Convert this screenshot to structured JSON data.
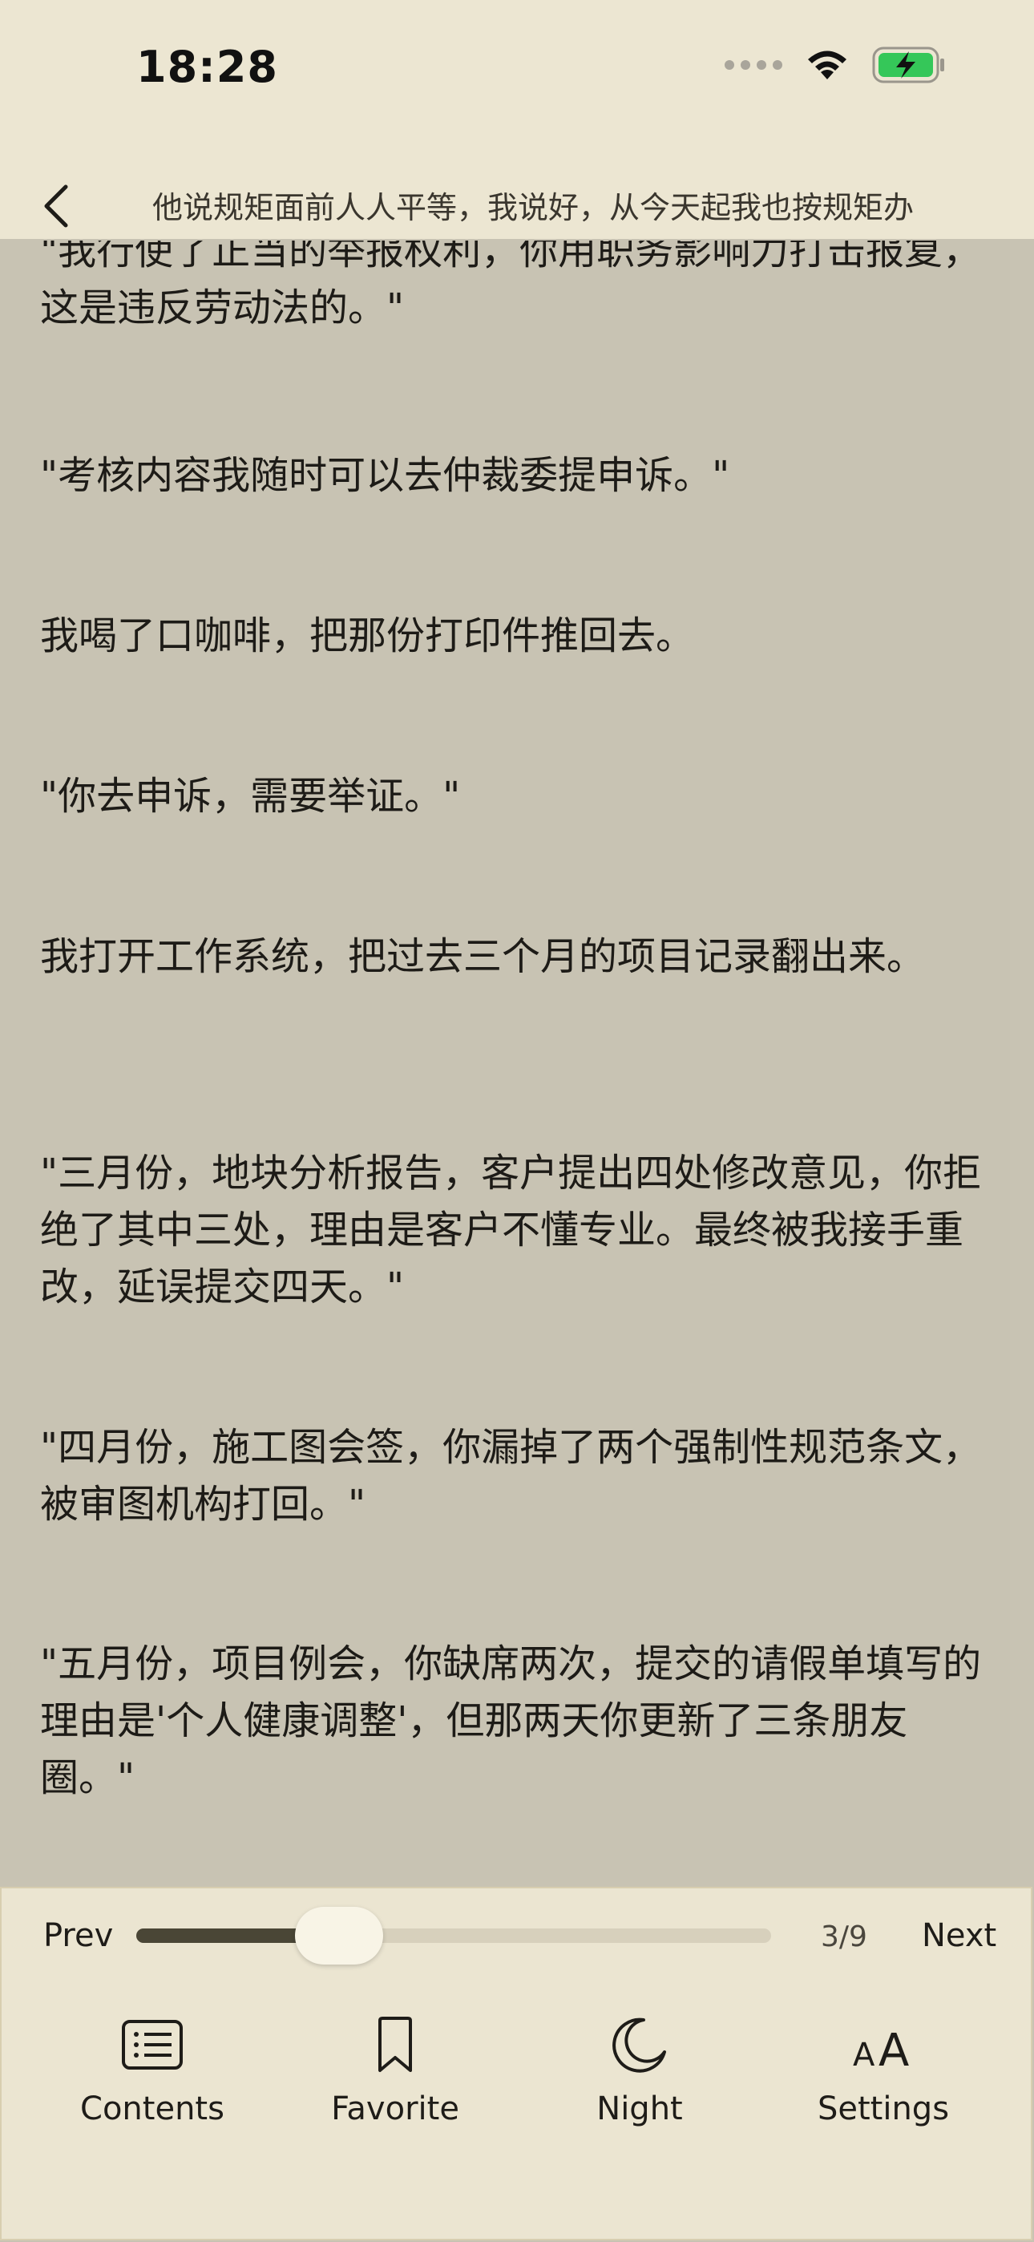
{
  "status": {
    "time": "18:28"
  },
  "header": {
    "title": "他说规矩面前人人平等，我说好，从今天起我也按规矩办"
  },
  "paragraphs": [
    "\"我行使了正当的举报权利，你用职务影响力打击报复，这是违反劳动法的。\"",
    "\"考核内容我随时可以去仲裁委提申诉。\"",
    "我喝了口咖啡，把那份打印件推回去。",
    "\"你去申诉，需要举证。\"",
    "我打开工作系统，把过去三个月的项目记录翻出来。",
    "\"三月份，地块分析报告，客户提出四处修改意见，你拒绝了其中三处，理由是客户不懂专业。最终被我接手重改，延误提交四天。\"",
    "\"四月份，施工图会签，你漏掉了两个强制性规范条文，被审图机构打回。\"",
    "\"五月份，项目例会，你缺席两次，提交的请假单填写的理由是'个人健康调整'，但那两天你更新了三条朋友圈。\""
  ],
  "progress": {
    "prev_label": "Prev",
    "next_label": "Next",
    "page_indicator": "3/9",
    "fraction": 0.32
  },
  "toolbar": {
    "contents_label": "Contents",
    "favorite_label": "Favorite",
    "night_label": "Night",
    "settings_label": "Settings"
  },
  "colors": {
    "page_bg": "#c8c3b3",
    "panel_bg": "#ebe5d1",
    "accent": "#4a4636",
    "battery": "#35c759"
  }
}
